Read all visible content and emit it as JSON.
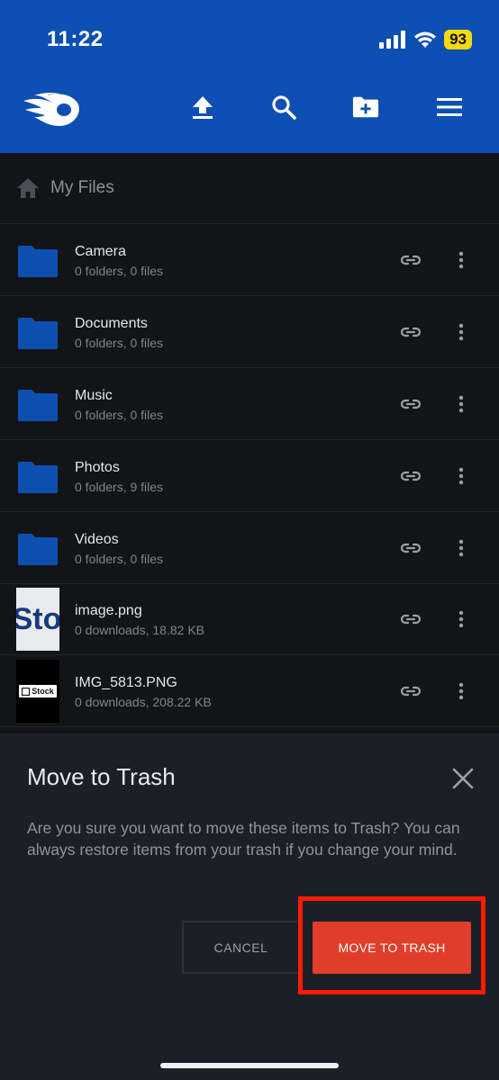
{
  "status_bar": {
    "time": "11:22",
    "battery": "93"
  },
  "toolbar": {
    "upload_icon": "upload-icon",
    "search_icon": "search-icon",
    "new_folder_icon": "new-folder-icon",
    "menu_icon": "menu-icon"
  },
  "breadcrumb": {
    "label": "My Files"
  },
  "items": [
    {
      "name": "Camera",
      "meta": "0 folders, 0 files",
      "kind": "folder"
    },
    {
      "name": "Documents",
      "meta": "0 folders, 0 files",
      "kind": "folder"
    },
    {
      "name": "Music",
      "meta": "0 folders, 0 files",
      "kind": "folder"
    },
    {
      "name": "Photos",
      "meta": "0 folders, 9 files",
      "kind": "folder"
    },
    {
      "name": "Videos",
      "meta": "0 folders, 0 files",
      "kind": "folder"
    },
    {
      "name": "image.png",
      "meta": "0 downloads, 18.82 KB",
      "kind": "image",
      "thumb_text": "Sto"
    },
    {
      "name": "IMG_5813.PNG",
      "meta": "0 downloads, 208.22 KB",
      "kind": "image",
      "thumb_text": "Stock"
    }
  ],
  "dialog": {
    "title": "Move to Trash",
    "message": "Are you sure you want to move these items to Trash? You can always restore items from your trash if you change your mind.",
    "cancel_label": "CANCEL",
    "confirm_label": "MOVE TO TRASH"
  },
  "colors": {
    "header": "#0d4fb2",
    "folder": "#0f4fb0",
    "confirm": "#e03e2a",
    "highlight": "#ff1a00"
  }
}
